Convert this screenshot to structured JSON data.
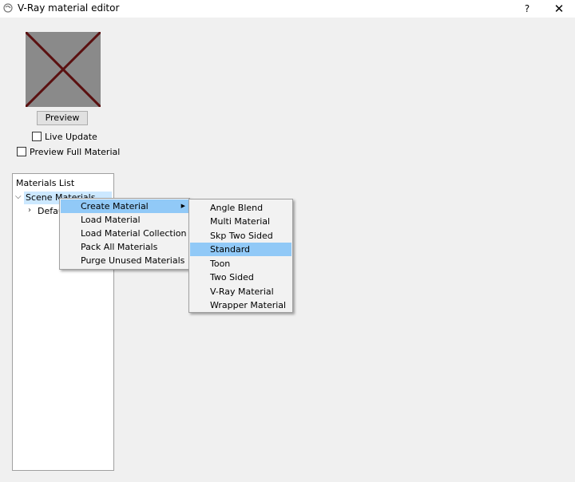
{
  "window": {
    "title": "V-Ray material editor",
    "help_label": "?",
    "close_label": "✕"
  },
  "preview": {
    "button_label": "Preview",
    "live_update_label": "Live Update",
    "live_update_checked": false,
    "preview_full_label": "Preview Full Material",
    "preview_full_checked": false
  },
  "materials_list": {
    "header": "Materials List",
    "scene_label": "Scene Materials",
    "default_label": "Default"
  },
  "context_menu": {
    "items": [
      {
        "label": "Create Material",
        "has_submenu": true,
        "highlighted": true
      },
      {
        "label": "Load Material"
      },
      {
        "label": "Load Material Collection"
      },
      {
        "label": "Pack All Materials"
      },
      {
        "label": "Purge Unused Materials"
      }
    ]
  },
  "submenu": {
    "items": [
      {
        "label": "Angle Blend"
      },
      {
        "label": "Multi Material"
      },
      {
        "label": "Skp Two Sided"
      },
      {
        "label": "Standard",
        "highlighted": true
      },
      {
        "label": "Toon"
      },
      {
        "label": "Two Sided"
      },
      {
        "label": "V-Ray Material"
      },
      {
        "label": "Wrapper Material"
      }
    ]
  },
  "colors": {
    "highlight": "#91c9f7",
    "tree_selection": "#cce8ff",
    "preview_fill": "#8a8a8a",
    "preview_cross": "#5a1010"
  }
}
